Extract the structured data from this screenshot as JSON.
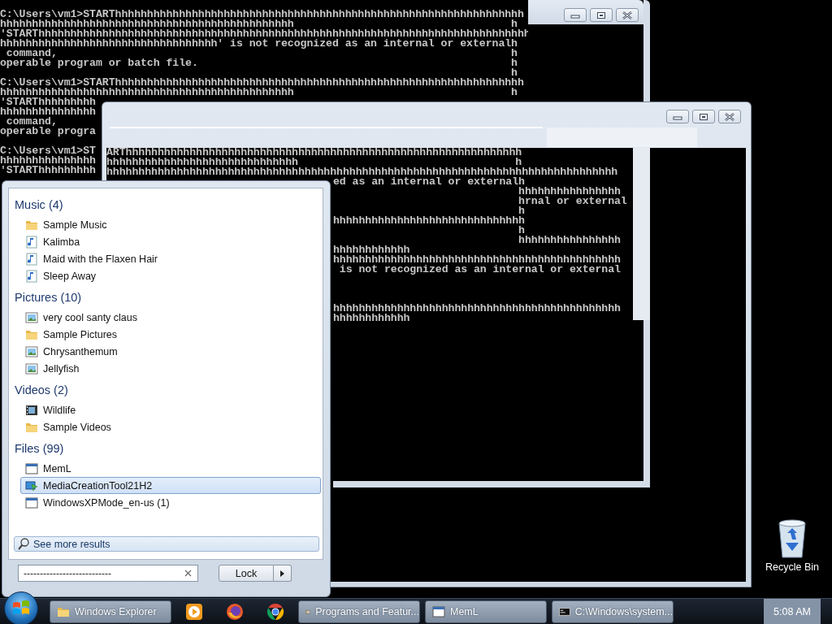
{
  "desktop_console": {
    "blocks": [
      [
        "C:\\Users\\vm1>STARThhhhhhhhhhhhhhhhhhhhhhhhhhhhhhhhhhhhhhhhhhhhhhhhhhhhhhhhhhhhhhhh",
        "hhhhhhhhhhhhhhhhhhhhhhhhhhhhhhhhhhhhhhhhhhhhhh                                  h",
        "'STARThhhhhhhhhhhhhhhhhhhhhhhhhhhhhhhhhhhhhhhhhhhhhhhhhhhhhhhhhhhhhhhhhhhhhhhhhhhhh",
        "hhhhhhhhhhhhhhhhhhhhhhhhhhhhhhhhhh' is not recognized as an internal or externalh",
        " command,                                                                       h",
        "operable program or batch file.                                                 h",
        "                                                                                h",
        "C:\\Users\\vm1>STARThhhhhhhhhhhhhhhhhhhhhhhhhhhhhhhhhhhhhhhhhhhhhhhhhhhhhhhhhhhhhhhh",
        "hhhhhhhhhhhhhhhhhhhhhhhhhhhhhhhhhhhhhhhhhhhhhh                                  h",
        "'STARThhhhhhhhh",
        "hhhhhhhhhhhhhhh",
        " command,",
        "operable progra"
      ],
      [
        "C:\\Users\\vm1>ST",
        "hhhhhhhhhhhhhhh",
        "'STARThhhhhhhhh"
      ]
    ]
  },
  "front_window": {
    "upper_rows": [
      "ARThhhhhhhhhhhhhhhhhhhhhhhhhhhhhhhhhhhhhhhhhhhhhhhhhhhhhhhhhhhhhh",
      "hhhhhhhhhhhhhhhhhhhhhhhhhhhhhh                                  h",
      "hhhhhhhhhhhhhhhhhhhhhhhhhhhhhhhhhhhhhhhhhhhhhhhhhhhhhhhhhhhhhhhhhhhhhhhhhhhhhhhh"
    ],
    "lower_blocks": [
      [
        "ed as an internal or externalh",
        "                             hhhhhhhhhhhhhhhh",
        "                             hrnal or external",
        "                             h",
        "hhhhhhhhhhhhhhhhhhhhhhhhhhhhhh",
        "                             h",
        "                             hhhhhhhhhhhhhhhh",
        "hhhhhhhhhhhh",
        "hhhhhhhhhhhhhhhhhhhhhhhhhhhhhhhhhhhhhhhhhhhhh",
        " is not recognized as an internal or external"
      ],
      [
        "hhhhhhhhhhhhhhhhhhhhhhhhhhhhhhhhhhhhhhhhhhhhh",
        "hhhhhhhhhhhh"
      ]
    ]
  },
  "start_menu": {
    "groups": [
      {
        "title": "Music (4)",
        "items": [
          {
            "label": "Sample Music",
            "kind": "folder",
            "selected": false
          },
          {
            "label": "Kalimba",
            "kind": "music",
            "selected": false
          },
          {
            "label": "Maid with the Flaxen Hair",
            "kind": "music",
            "selected": false
          },
          {
            "label": "Sleep Away",
            "kind": "music",
            "selected": false
          }
        ]
      },
      {
        "title": "Pictures (10)",
        "items": [
          {
            "label": "very cool santy claus",
            "kind": "image",
            "selected": false
          },
          {
            "label": "Sample Pictures",
            "kind": "folder",
            "selected": false
          },
          {
            "label": "Chrysanthemum",
            "kind": "image",
            "selected": false
          },
          {
            "label": "Jellyfish",
            "kind": "image",
            "selected": false
          }
        ]
      },
      {
        "title": "Videos (2)",
        "items": [
          {
            "label": "Wildlife",
            "kind": "video",
            "selected": false
          },
          {
            "label": "Sample Videos",
            "kind": "folder",
            "selected": false
          }
        ]
      },
      {
        "title": "Files (99)",
        "items": [
          {
            "label": "MemL",
            "kind": "app",
            "selected": false
          },
          {
            "label": "MediaCreationTool21H2",
            "kind": "setup",
            "selected": true
          },
          {
            "label": "WindowsXPMode_en-us (1)",
            "kind": "app",
            "selected": false
          }
        ]
      }
    ],
    "see_more": "See more results",
    "search": {
      "value": "---------------------------"
    },
    "power_button": "Lock"
  },
  "desktop_icons": [
    {
      "label": "Recycle Bin"
    }
  ],
  "taskbar": {
    "buttons": [
      {
        "kind": "task",
        "label": "Windows Explorer"
      },
      {
        "kind": "pinned"
      },
      {
        "kind": "pinned"
      },
      {
        "kind": "pinned"
      },
      {
        "kind": "task",
        "label": "Programs and Featur..."
      },
      {
        "kind": "task",
        "label": "MemL"
      },
      {
        "kind": "task",
        "label": "C:\\Windows\\system..."
      }
    ],
    "clock": "5:08 AM"
  }
}
